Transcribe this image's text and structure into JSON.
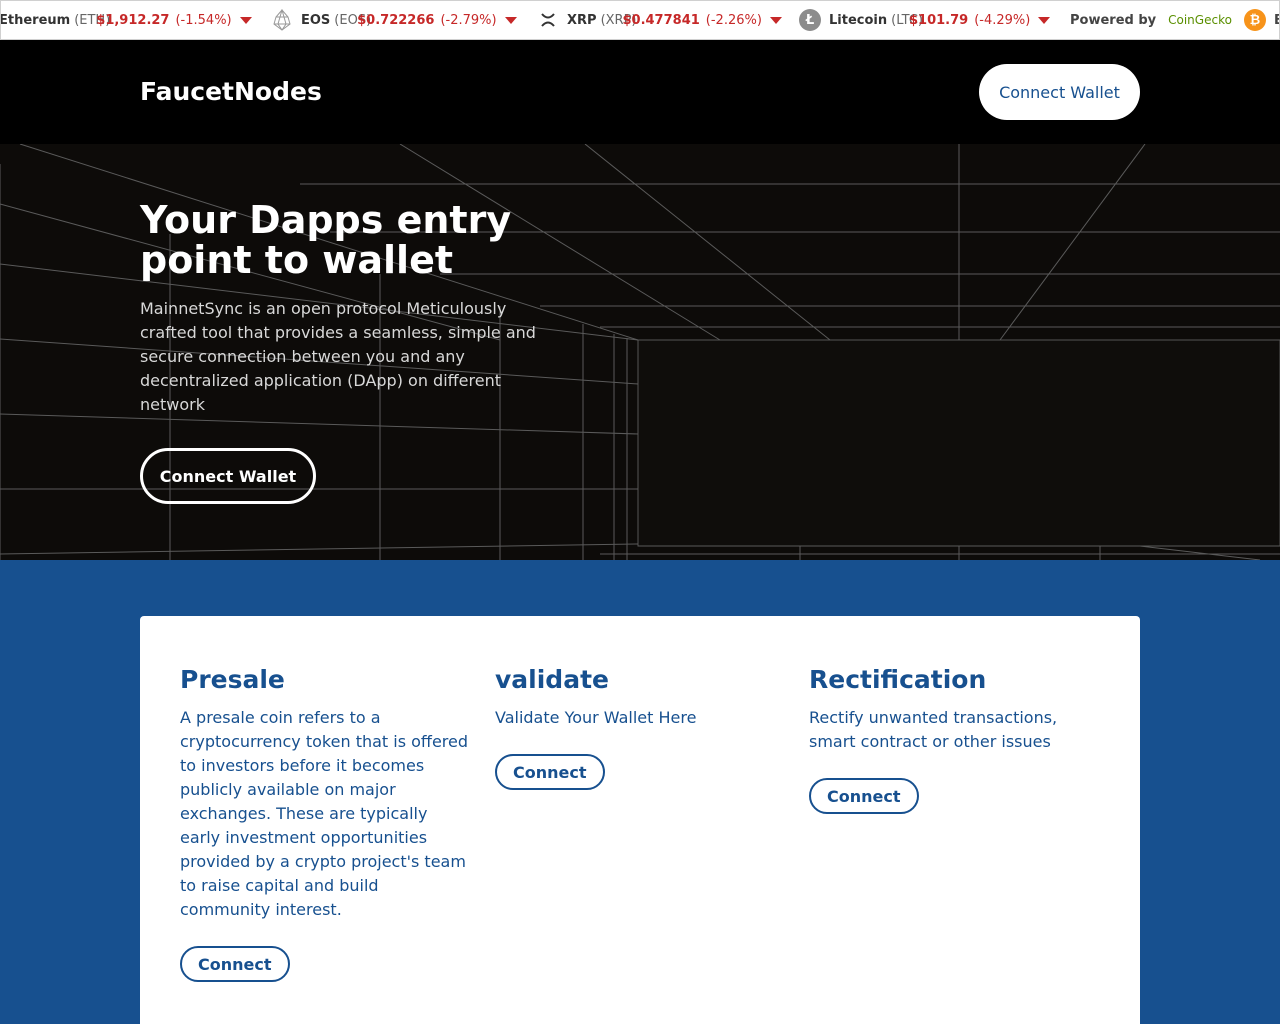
{
  "ticker": {
    "items": [
      {
        "name": "Ethereum",
        "symbol": "(ETH)",
        "price": "$1,912.27",
        "change": "(-1.54%)",
        "icon": "ethereum-icon"
      },
      {
        "name": "EOS",
        "symbol": "(EOS)",
        "price": "$0.722266",
        "change": "(-2.79%)",
        "icon": "eos-icon"
      },
      {
        "name": "XRP",
        "symbol": "(XRP)",
        "price": "$0.477841",
        "change": "(-2.26%)",
        "icon": "xrp-icon"
      },
      {
        "name": "Litecoin",
        "symbol": "(LTC)",
        "price": "$101.79",
        "change": "(-4.29%)",
        "icon": "litecoin-icon"
      }
    ],
    "powered_by": "Powered by",
    "provider": "CoinGecko",
    "trailing_text": "B",
    "down_color": "#c62828"
  },
  "header": {
    "logo": "FaucetNodes",
    "connect_label": "Connect Wallet"
  },
  "hero": {
    "title": "Your Dapps entry point to wallet",
    "description": "MainnetSync is an open protocol Meticulously crafted tool that provides a seamless, simple and secure connection between you and any decentralized application (DApp) on different network",
    "button_label": "Connect Wallet"
  },
  "services": [
    {
      "title": "Presale",
      "text": "A presale coin refers to a cryptocurrency token that is offered to investors before it becomes publicly available on major exchanges. These are typically early investment opportunities provided by a crypto project's team to raise capital and build community interest.",
      "button": "Connect"
    },
    {
      "title": "validate",
      "text": "Validate Your Wallet Here",
      "button": "Connect"
    },
    {
      "title": "Rectification",
      "text": "Rectify unwanted transactions, smart contract or other issues",
      "button": "Connect"
    }
  ],
  "colors": {
    "brand": "#17508f",
    "header_bg": "#000000",
    "hero_bg": "#0d0b09"
  }
}
